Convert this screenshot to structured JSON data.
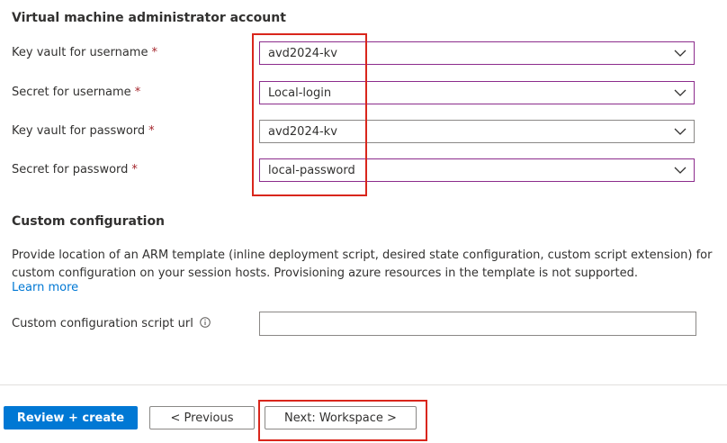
{
  "vm_admin": {
    "title": "Virtual machine administrator account",
    "fields": [
      {
        "label": "Key vault for username",
        "required": "*",
        "value": "avd2024-kv"
      },
      {
        "label": "Secret for username",
        "required": "*",
        "value": "Local-login"
      },
      {
        "label": "Key vault for password",
        "required": "*",
        "value": "avd2024-kv"
      },
      {
        "label": "Secret for password",
        "required": "*",
        "value": "local-password"
      }
    ]
  },
  "custom_config": {
    "title": "Custom configuration",
    "description": "Provide location of an ARM template (inline deployment script, desired state configuration, custom script extension) for custom configuration on your session hosts. Provisioning azure resources in the template is not supported.",
    "learn_more": "Learn more",
    "script_url_label": "Custom configuration script url",
    "script_url_value": ""
  },
  "footer": {
    "review_create": "Review + create",
    "previous": "< Previous",
    "next": "Next: Workspace >"
  },
  "colors": {
    "accent": "#0078d4",
    "focus_border": "#8c2c8c",
    "required": "#a4262c",
    "highlight": "#d9261c"
  }
}
